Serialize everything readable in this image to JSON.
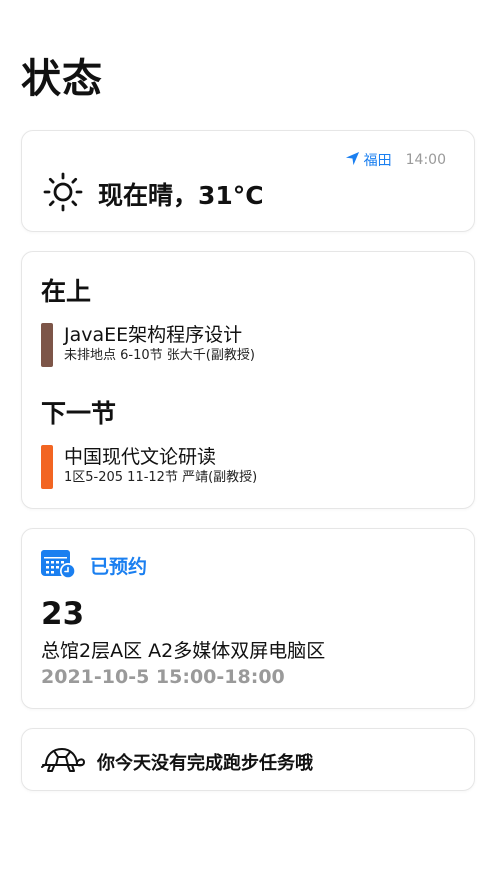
{
  "page": {
    "title": "状态"
  },
  "weather": {
    "location": "福田",
    "time": "14:00",
    "summary": "现在晴，31°C",
    "icon": "sun-icon"
  },
  "classes": {
    "current_heading": "在上",
    "current": {
      "name": "JavaEE架构程序设计",
      "detail": "未排地点 6-10节 张大千(副教授)",
      "color": "#7d5548"
    },
    "next_heading": "下一节",
    "next": {
      "name": "中国现代文论研读",
      "detail": "1区5-205 11-12节 严靖(副教授)",
      "color": "#f26522"
    }
  },
  "reservation": {
    "status": "已预约",
    "icon": "calendar-clock-icon",
    "number": "23",
    "location": "总馆2层A区 A2多媒体双屏电脑区",
    "time": "2021-10-5 15:00-18:00"
  },
  "run": {
    "icon": "turtle-icon",
    "message": "你今天没有完成跑步任务哦"
  },
  "colors": {
    "accent": "#1a7ff0",
    "muted": "#9a9a9a"
  }
}
